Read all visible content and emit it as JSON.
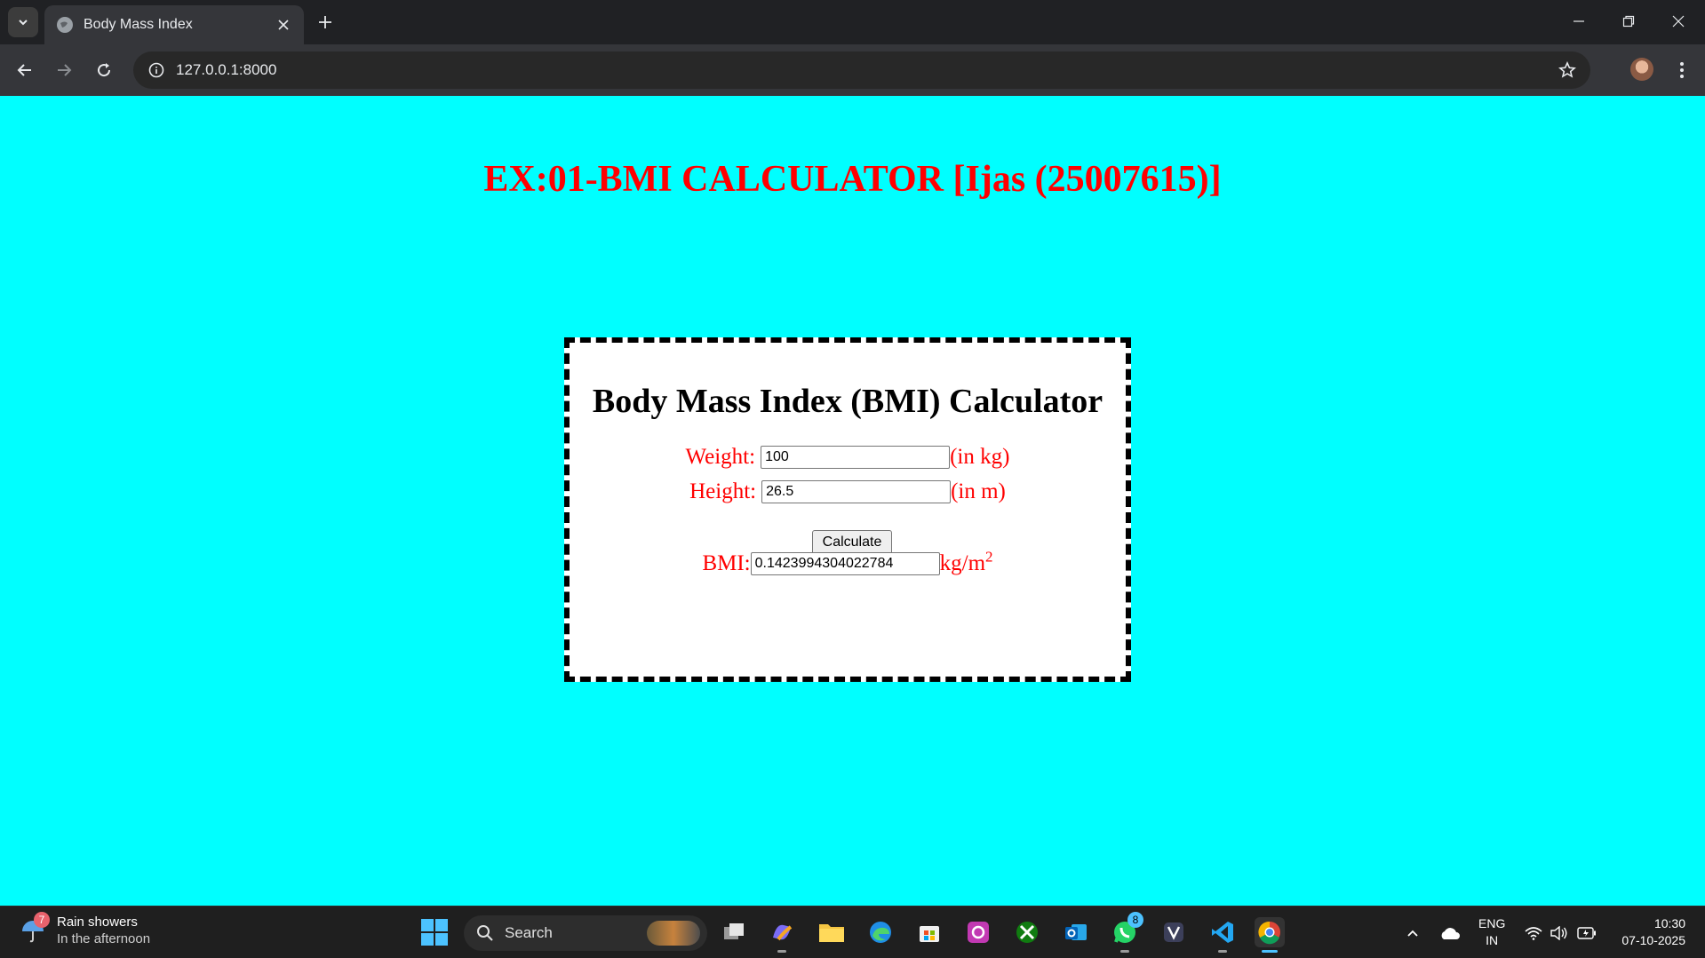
{
  "browser": {
    "tab_title": "Body Mass Index",
    "url": "127.0.0.1:8000"
  },
  "page": {
    "title": "EX:01-BMI CALCULATOR [Ijas (25007615)]",
    "calculator": {
      "heading": "Body Mass Index (BMI) Calculator",
      "weight_label": "Weight:",
      "weight_value": "100",
      "weight_unit": "(in kg)",
      "height_label": "Height:",
      "height_value": "26.5",
      "height_unit": "(in m)",
      "button_label": "Calculate",
      "bmi_label": "BMI:",
      "bmi_value": "0.1423994304022784",
      "bmi_unit": "kg/m",
      "bmi_unit_sup": "2"
    }
  },
  "taskbar": {
    "weather_badge": "7",
    "weather_title": "Rain showers",
    "weather_subtitle": "In the afternoon",
    "search_label": "Search",
    "whatsapp_badge": "8",
    "lang_line1": "ENG",
    "lang_line2": "IN",
    "time": "10:30",
    "date": "07-10-2025"
  },
  "colors": {
    "page_background": "#00ffff",
    "title_color": "#ff0000",
    "label_color": "#ff0000",
    "box_border": "#000000"
  }
}
